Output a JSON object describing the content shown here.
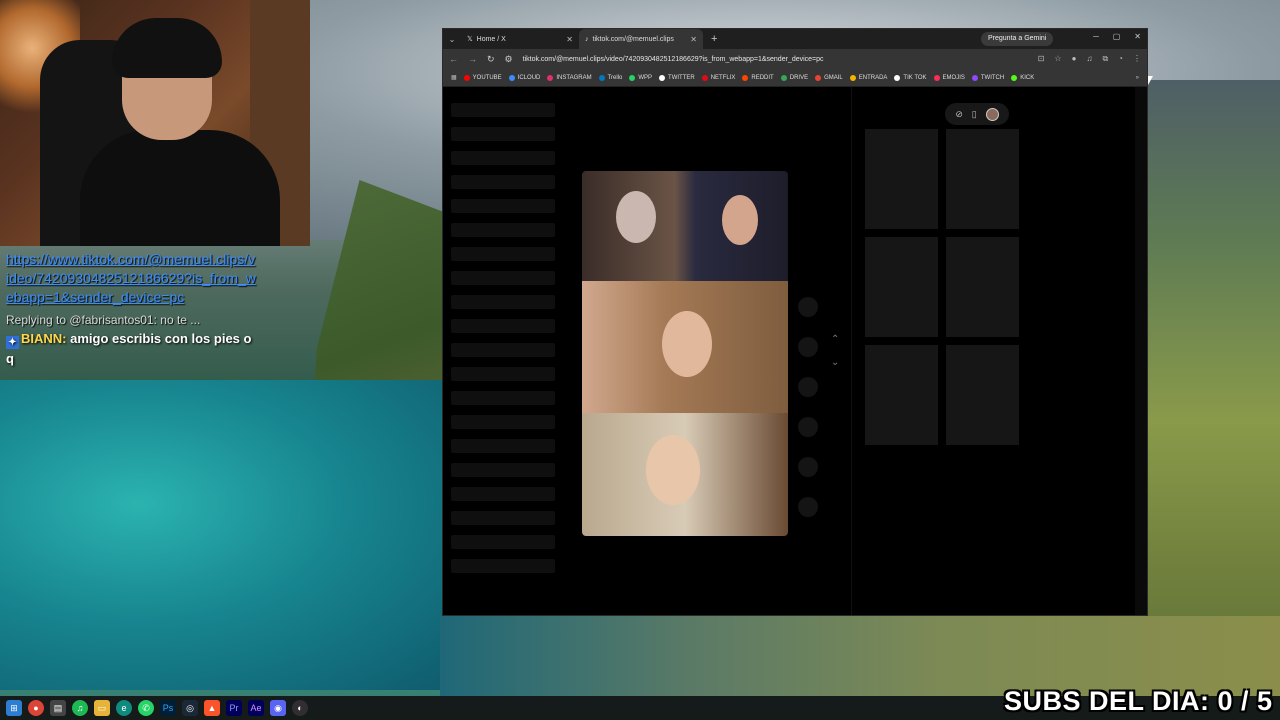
{
  "desktop": {
    "subs_counter": "SUBS DEL DIA: 0 / 5"
  },
  "chat": {
    "url_text": "https://www.tiktok.com/@memuel.clips/video/7420930482512186629?is_from_webapp=1&sender_device=pc",
    "reply_prefix": "Replying to @fabrisantos01: no te ...",
    "username": "BIANN:",
    "message": "amigo escribis con los pies o q"
  },
  "browser": {
    "tabs": [
      {
        "label": "Home / X",
        "icon": "x-logo-icon"
      },
      {
        "label": "tiktok.com/@memuel.clips",
        "icon": "tiktok-icon",
        "active": true
      }
    ],
    "gemini_button": "Pregunta a Gemini",
    "address": "tiktok.com/@memuel.clips/video/7420930482512186629?is_from_webapp=1&sender_device=pc",
    "bookmarks": [
      {
        "label": "YOUTUBE",
        "color": "#ff0000"
      },
      {
        "label": "ICLOUD",
        "color": "#3b8cff"
      },
      {
        "label": "INSTAGRAM",
        "color": "#e1306c"
      },
      {
        "label": "Trello",
        "color": "#0079bf"
      },
      {
        "label": "WPP",
        "color": "#25d366"
      },
      {
        "label": "TWITTER",
        "color": "#ffffff"
      },
      {
        "label": "NETFLIX",
        "color": "#e50914"
      },
      {
        "label": "REDDIT",
        "color": "#ff4500"
      },
      {
        "label": "DRIVE",
        "color": "#34a853"
      },
      {
        "label": "GMAIL",
        "color": "#ea4335"
      },
      {
        "label": "ENTRADA",
        "color": "#f4b400"
      },
      {
        "label": "TIK TOK",
        "color": "#ffffff"
      },
      {
        "label": "EMOJIS",
        "color": "#ff2d55"
      },
      {
        "label": "TWITCH",
        "color": "#9146ff"
      },
      {
        "label": "KICK",
        "color": "#53fc18"
      }
    ]
  },
  "taskbar": {
    "icons": [
      "windows-start-icon",
      "chrome-icon",
      "task-view-icon",
      "spotify-icon",
      "file-explorer-icon",
      "edge-icon",
      "whatsapp-icon",
      "photoshop-icon",
      "steam-icon",
      "brave-icon",
      "premiere-icon",
      "after-effects-icon",
      "discord-icon",
      "obs-icon"
    ]
  }
}
